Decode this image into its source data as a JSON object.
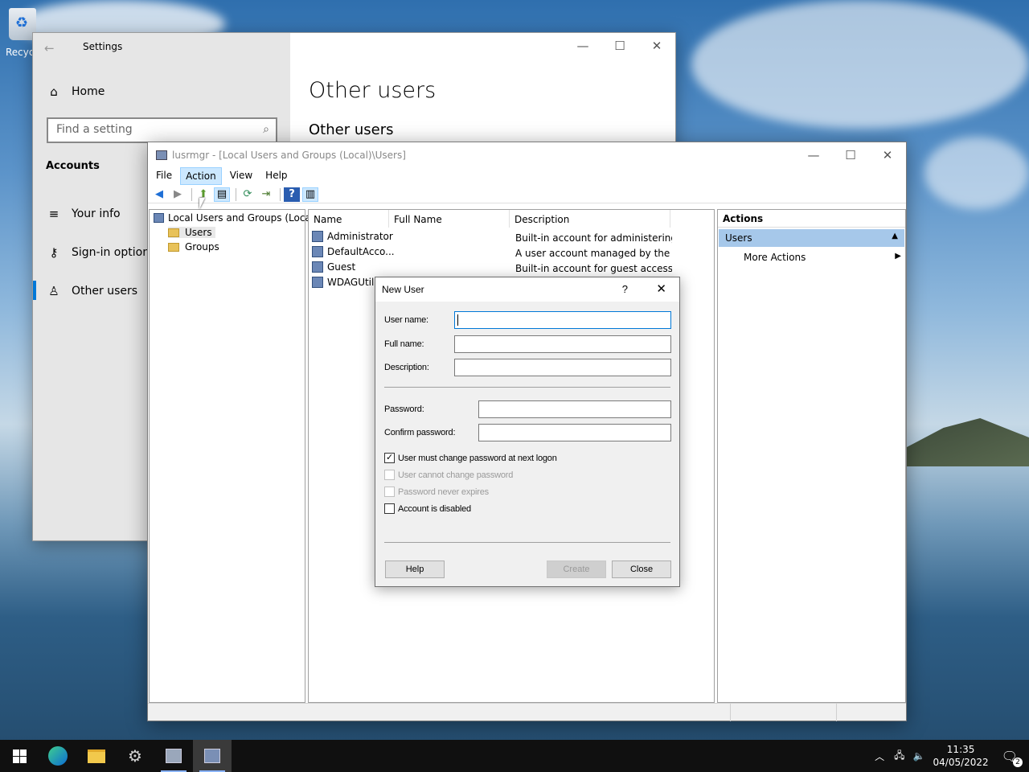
{
  "desktop": {
    "recycle_label": "Recycl"
  },
  "settings": {
    "title": "Settings",
    "home": "Home",
    "search_placeholder": "Find a setting",
    "section": "Accounts",
    "nav": [
      "Your info",
      "Sign-in options",
      "Other users"
    ],
    "page_title": "Other users",
    "subheading": "Other users"
  },
  "lusr": {
    "title": "lusrmgr - [Local Users and Groups (Local)\\Users]",
    "menu": [
      "File",
      "Action",
      "View",
      "Help"
    ],
    "tree": {
      "root": "Local Users and Groups (Local)",
      "children": [
        "Users",
        "Groups"
      ]
    },
    "columns": [
      "Name",
      "Full Name",
      "Description"
    ],
    "rows": [
      {
        "name": "Administrator",
        "full": "",
        "desc": "Built-in account for administering..."
      },
      {
        "name": "DefaultAcco...",
        "full": "",
        "desc": "A user account managed by the s..."
      },
      {
        "name": "Guest",
        "full": "",
        "desc": "Built-in account for guest access t..."
      },
      {
        "name": "WDAGUtilit",
        "full": "",
        "desc": ""
      }
    ],
    "actions": {
      "header": "Actions",
      "group": "Users",
      "item": "More Actions"
    }
  },
  "dialog": {
    "title": "New User",
    "help_glyph": "?",
    "labels": {
      "username": "User name:",
      "fullname": "Full name:",
      "description": "Description:",
      "password": "Password:",
      "confirm": "Confirm password:"
    },
    "values": {
      "username": "",
      "fullname": "",
      "description": "",
      "password": "",
      "confirm": ""
    },
    "checks": [
      {
        "label": "User must change password at next logon",
        "checked": true,
        "enabled": true
      },
      {
        "label": "User cannot change password",
        "checked": false,
        "enabled": false
      },
      {
        "label": "Password never expires",
        "checked": false,
        "enabled": false
      },
      {
        "label": "Account is disabled",
        "checked": false,
        "enabled": true
      }
    ],
    "buttons": {
      "help": "Help",
      "create": "Create",
      "close": "Close"
    }
  },
  "taskbar": {
    "time": "11:35",
    "date": "04/05/2022",
    "notifications": "2"
  },
  "colors": {
    "accent": "#0078d7",
    "selection": "#cce8ff",
    "actions_header": "#a6c8ea"
  }
}
